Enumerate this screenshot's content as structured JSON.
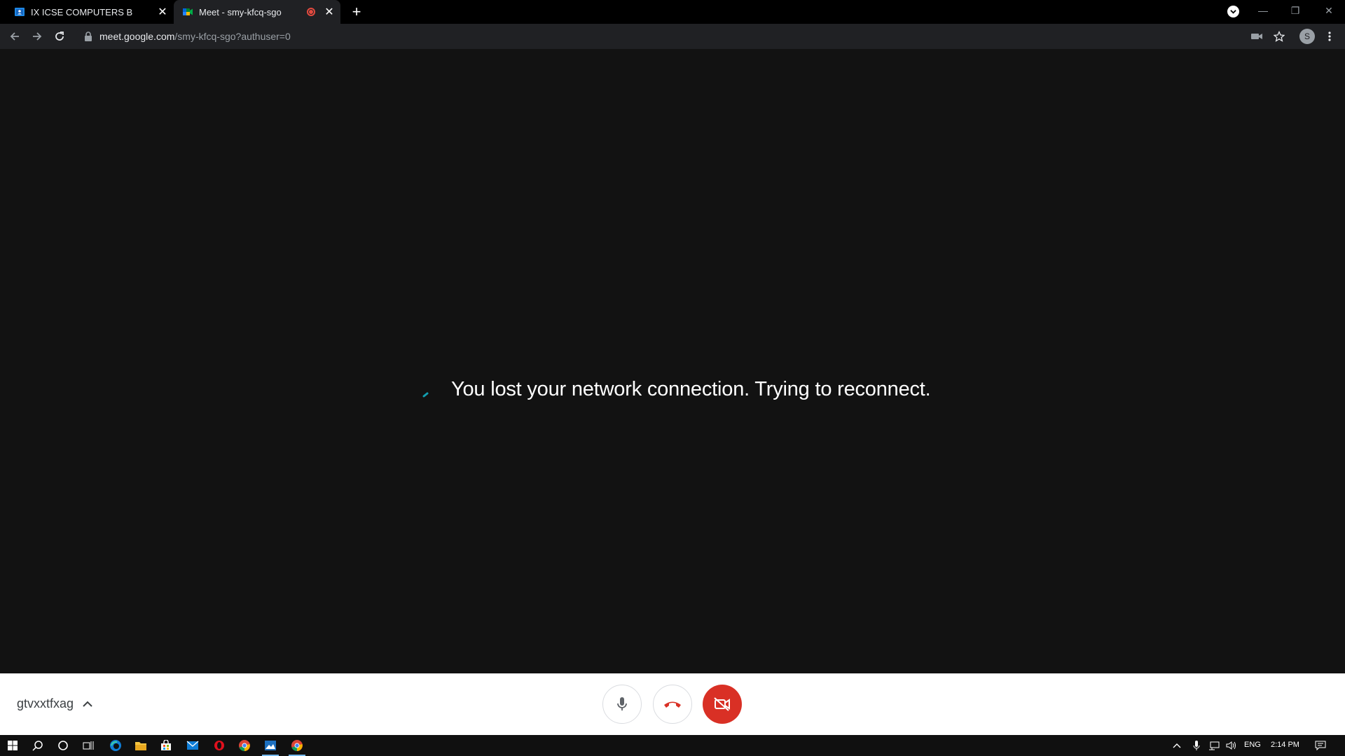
{
  "browser": {
    "tabs": [
      {
        "title": "IX ICSE COMPUTERS B",
        "favicon": "classroom-icon",
        "active": false
      },
      {
        "title": "Meet - smy-kfcq-sgo",
        "favicon": "meet-icon",
        "active": true,
        "recording": true
      }
    ],
    "address": {
      "host": "meet.google.com",
      "path": "/smy-kfcq-sgo?authuser=0"
    },
    "profile_initial": "S"
  },
  "meet": {
    "status_message": "You lost your network connection. Trying to reconnect.",
    "meeting_code": "gtvxxtfxag"
  },
  "taskbar": {
    "language": "ENG",
    "time": "2:14 PM"
  },
  "colors": {
    "stage_bg": "#121212",
    "hangup_red": "#d93025",
    "spinner_teal": "#129eaf"
  }
}
